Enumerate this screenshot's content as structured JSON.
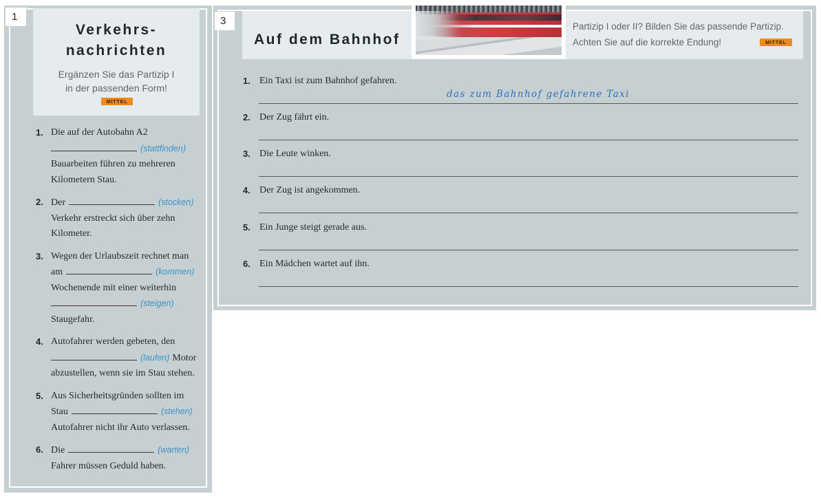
{
  "colors": {
    "panel": "#c6d0d3",
    "header": "#e6ebed",
    "level_badge": "#ef8a22",
    "hint": "#3b90c9",
    "handwriting": "#2d70b7"
  },
  "exercise1": {
    "number": "1",
    "title_line1": "Verkehrs-",
    "title_line2": "nachrichten",
    "instruction_line1": "Ergänzen Sie das Partizip I",
    "instruction_line2": "in der passenden Form!",
    "level": "MITTEL",
    "items": [
      {
        "number": "1.",
        "lines": [
          {
            "text": "Die auf der Autobahn A2"
          },
          {
            "hint": "(stattfinden)"
          },
          {
            "text": "Bauarbeiten führen zu mehreren"
          },
          {
            "text": "Kilometern Stau."
          }
        ]
      },
      {
        "number": "2.",
        "lines": [
          {
            "before": "Der",
            "hint": "(stocken)"
          },
          {
            "text": "Verkehr erstreckt sich über zehn"
          },
          {
            "text": "Kilometer."
          }
        ]
      },
      {
        "number": "3.",
        "lines": [
          {
            "text": "Wegen der Urlaubszeit rechnet man"
          },
          {
            "before": "am",
            "hint": "(kommen)"
          },
          {
            "text": "Wochenende mit einer weiterhin"
          },
          {
            "hint": "(steigen)"
          },
          {
            "text": "Staugefahr."
          }
        ]
      },
      {
        "number": "4.",
        "lines": [
          {
            "text": "Autofahrer werden gebeten, den"
          },
          {
            "hint": "(laufen)",
            "after": "Motor"
          },
          {
            "text": "abzustellen, wenn sie im Stau stehen."
          }
        ]
      },
      {
        "number": "5.",
        "lines": [
          {
            "text": "Aus Sicherheitsgründen sollten im"
          },
          {
            "before": "Stau",
            "hint": "(stehen)"
          },
          {
            "text": "Autofahrer nicht ihr Auto verlassen."
          }
        ]
      },
      {
        "number": "6.",
        "lines": [
          {
            "before": "Die",
            "hint": "(warten)"
          },
          {
            "text": "Fahrer müssen Geduld haben."
          }
        ]
      }
    ]
  },
  "exercise3": {
    "number": "3",
    "title": "Auf dem Bahnhof",
    "instruction_line1": "Partizip I oder II? Bilden Sie das passende Partizip.",
    "instruction_line2": "Achten Sie auf die korrekte Endung!",
    "level": "MITTEL",
    "items": [
      {
        "number": "1.",
        "sentence": "Ein Taxi ist zum Bahnhof gefahren.",
        "answer": "das zum Bahnhof gefahrene Taxi"
      },
      {
        "number": "2.",
        "sentence": "Der Zug fährt ein."
      },
      {
        "number": "3.",
        "sentence": "Die Leute winken."
      },
      {
        "number": "4.",
        "sentence": "Der Zug ist angekommen."
      },
      {
        "number": "5.",
        "sentence": "Ein Junge steigt gerade aus."
      },
      {
        "number": "6.",
        "sentence": "Ein Mädchen wartet auf ihn."
      }
    ]
  }
}
